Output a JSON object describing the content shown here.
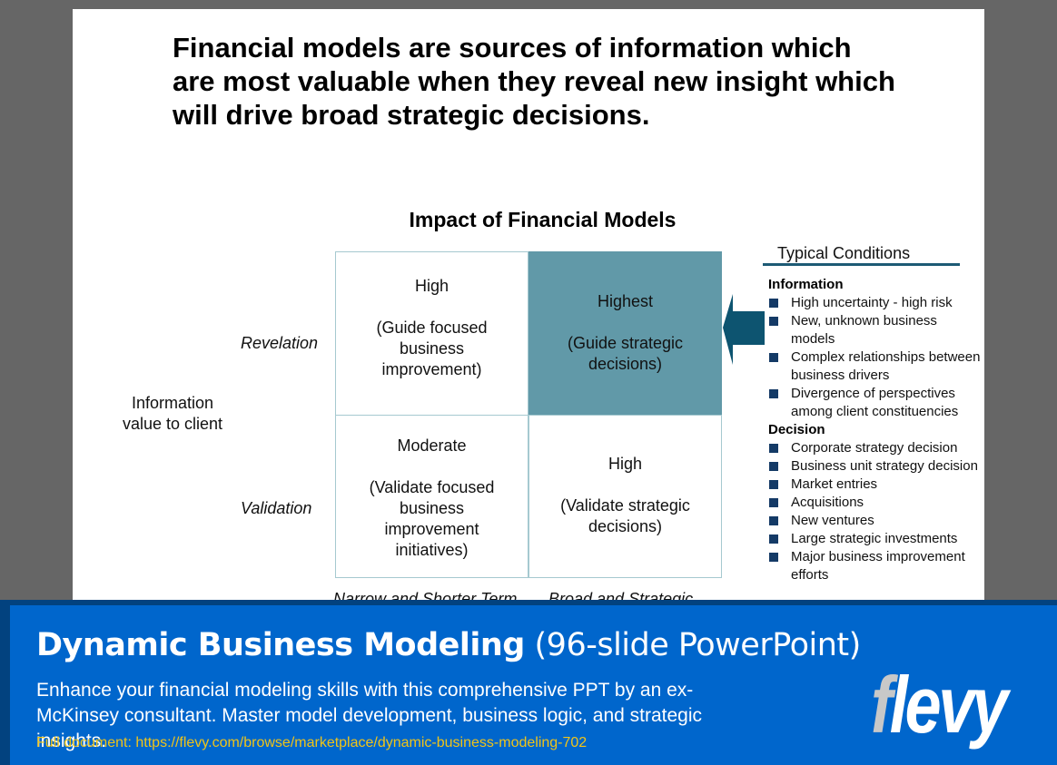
{
  "slide": {
    "headline": "Financial models are sources of information which are most valuable when they reveal new insight which will drive broad strategic decisions.",
    "chart_title": "Impact of Financial Models",
    "y_axis_title": "Information value to client",
    "row_labels": [
      "Revelation",
      "Validation"
    ],
    "column_labels": [
      "Narrow and Shorter Term",
      "Broad and Strategic"
    ],
    "cells": {
      "top_left": {
        "level": "High",
        "description": "(Guide focused business improvement)"
      },
      "top_right": {
        "level": "Highest",
        "description": "(Guide strategic decisions)",
        "highlighted": true
      },
      "bottom_left": {
        "level": "Moderate",
        "description": "(Validate focused business improvement initiatives)"
      },
      "bottom_right": {
        "level": "High",
        "description": "(Validate strategic decisions)"
      }
    },
    "colors": {
      "highlight": "#6199a8",
      "arrow": "#0d5470",
      "bullet": "#143a66",
      "grid_line": "#a6c9d0"
    },
    "conditions": {
      "title": "Typical Conditions",
      "sections": [
        {
          "heading": "Information",
          "items": [
            "High uncertainty - high risk",
            "New, unknown business models",
            "Complex relationships between business drivers",
            "Divergence of perspectives among client constituencies"
          ]
        },
        {
          "heading": "Decision",
          "items": [
            "Corporate strategy decision",
            "Business unit strategy decision",
            "Market entries",
            "Acquisitions",
            "New ventures",
            "Large strategic investments",
            "Major business improvement efforts"
          ]
        }
      ]
    }
  },
  "banner": {
    "title_bold": "Dynamic Business Modeling",
    "title_light": "(96-slide PowerPoint)",
    "description": "Enhance your financial modeling skills with this comprehensive PPT by an ex-McKinsey consultant. Master model development, business logic, and strategic insights.",
    "link": "Full document: https://flevy.com/browse/marketplace/dynamic-business-modeling-702",
    "logo_first": "f",
    "logo_rest": "levy",
    "colors": {
      "background": "#0066cc",
      "border": "#02427f",
      "link": "#f0c419"
    }
  }
}
